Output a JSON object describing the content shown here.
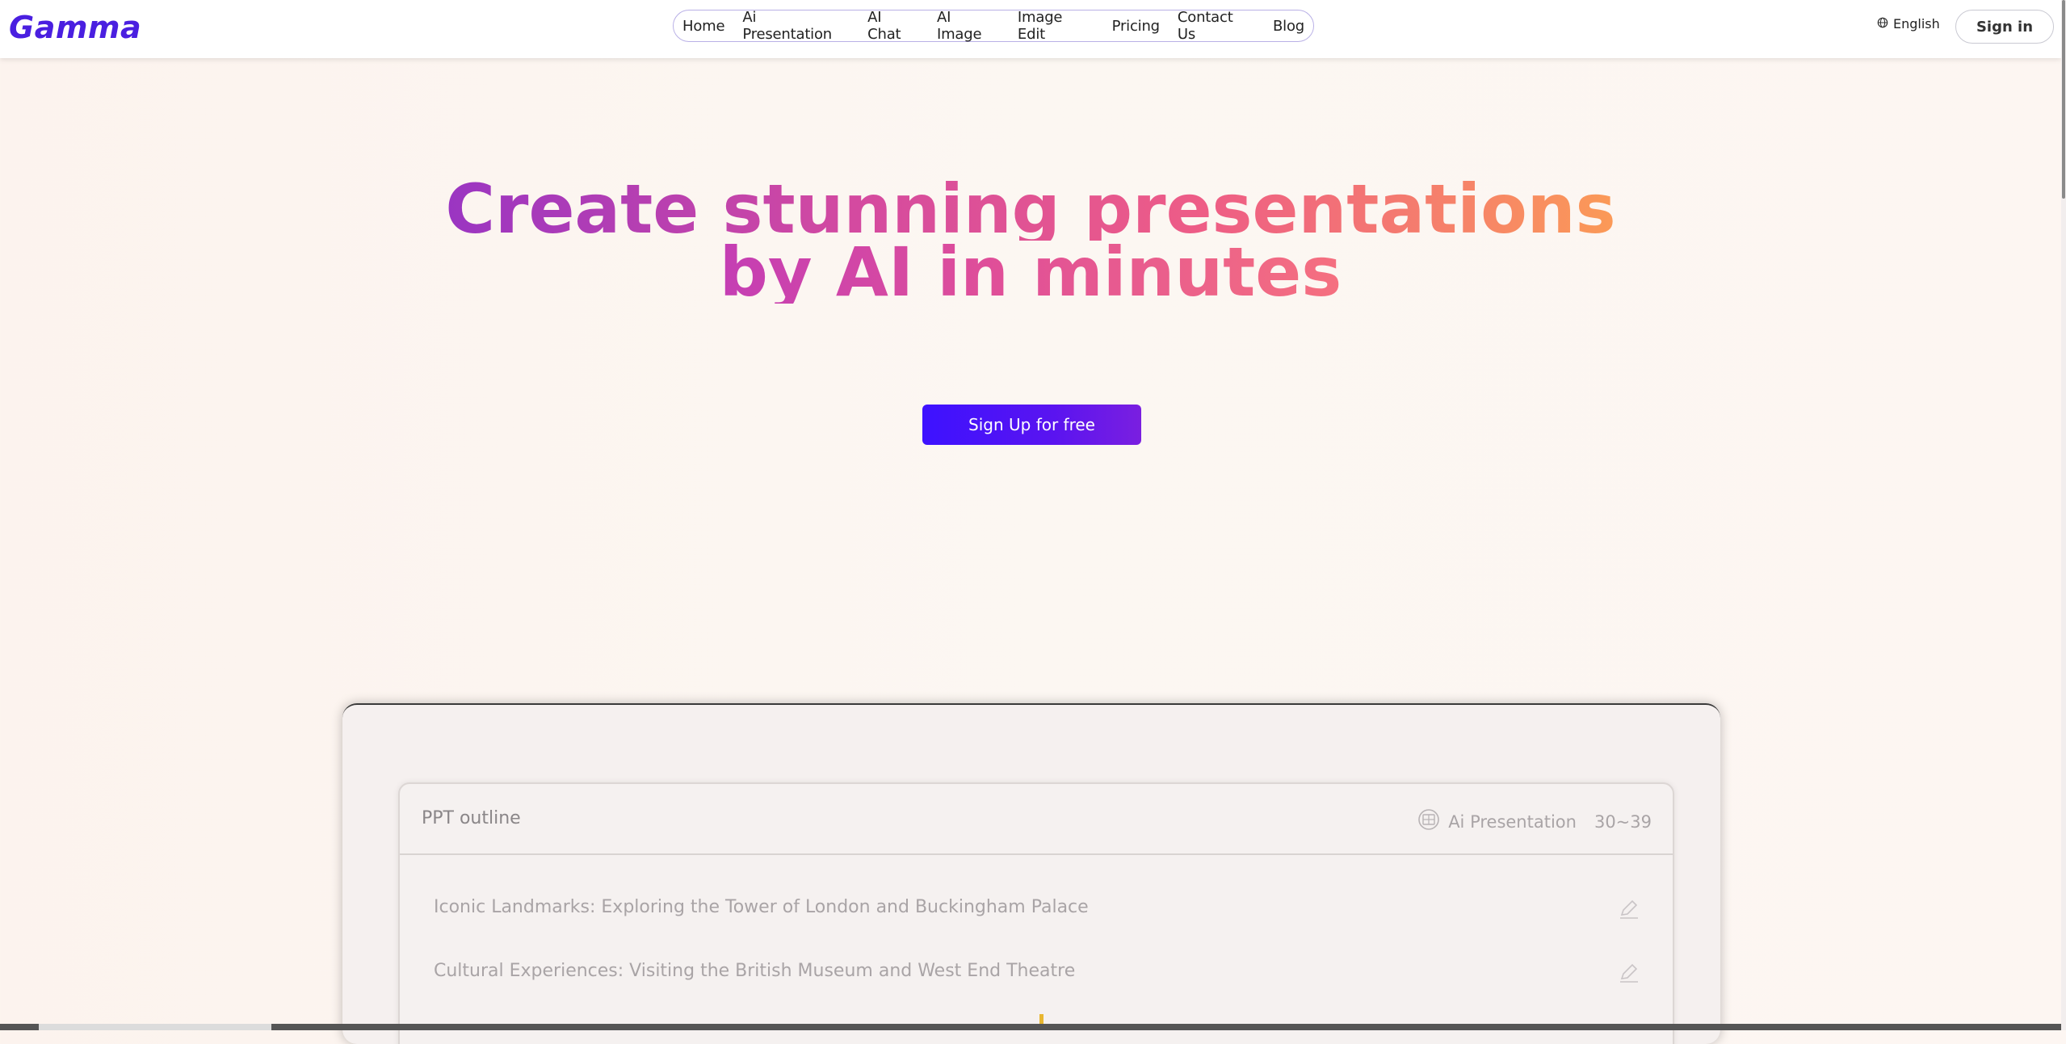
{
  "header": {
    "logo": "Gamma",
    "nav": [
      "Home",
      "Ai Presentation",
      "AI Chat",
      "AI Image",
      "Image Edit",
      "Pricing",
      "Contact Us",
      "Blog"
    ],
    "language": "English",
    "sign_in": "Sign in"
  },
  "hero": {
    "title_line1": "Create stunning presentations",
    "title_line2": "by AI in minutes",
    "cta": "Sign Up for free"
  },
  "preview": {
    "outline_title": "PPT outline",
    "meta_label": "Ai Presentation",
    "meta_count": "30~39",
    "items": [
      "Iconic Landmarks: Exploring the Tower of London and Buckingham Palace",
      "Cultural Experiences: Visiting the British Museum and West End Theatre"
    ]
  },
  "colors": {
    "brand": "#4a1fe0",
    "cta_start": "#3d12ff",
    "cta_end": "#7a1fe0",
    "title_gradient": [
      "#9a35c2",
      "#d44aa0",
      "#ee5d86",
      "#fb9a57"
    ]
  },
  "icons": [
    "globe-icon",
    "translate-icon",
    "pencil-icon"
  ]
}
